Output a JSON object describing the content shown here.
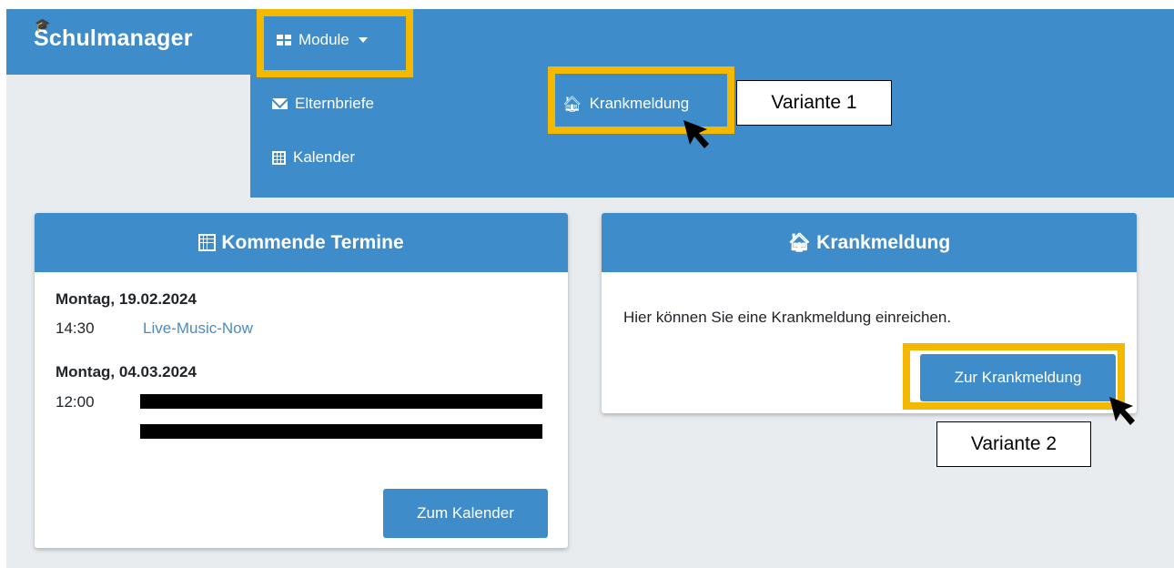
{
  "navbar": {
    "brand": "Schulmanager",
    "module_label": "Module"
  },
  "dropdown": {
    "items": [
      {
        "label": "Elternbriefe",
        "icon": "envelope-icon"
      },
      {
        "label": "Kalender",
        "icon": "calendar-icon"
      },
      {
        "label": "Krankmeldung",
        "icon": "home-icon"
      }
    ]
  },
  "annotations": {
    "variant1": "Variante 1",
    "variant2": "Variante 2",
    "highlight_color": "#f5b800"
  },
  "termine_card": {
    "title": "Kommende Termine",
    "events": [
      {
        "date": "Montag, 19.02.2024",
        "time": "14:30",
        "title": "Live-Music-Now"
      },
      {
        "date": "Montag, 04.03.2024",
        "time": "12:00",
        "title": ""
      }
    ],
    "button_label": "Zum Kalender"
  },
  "krank_card": {
    "title": "Krankmeldung",
    "text": "Hier können Sie eine Krankmeldung einreichen.",
    "button_label": "Zur Krankmeldung"
  },
  "colors": {
    "primary": "#3f8ccb",
    "background": "#e9ecef",
    "link": "#4a8bc7"
  }
}
